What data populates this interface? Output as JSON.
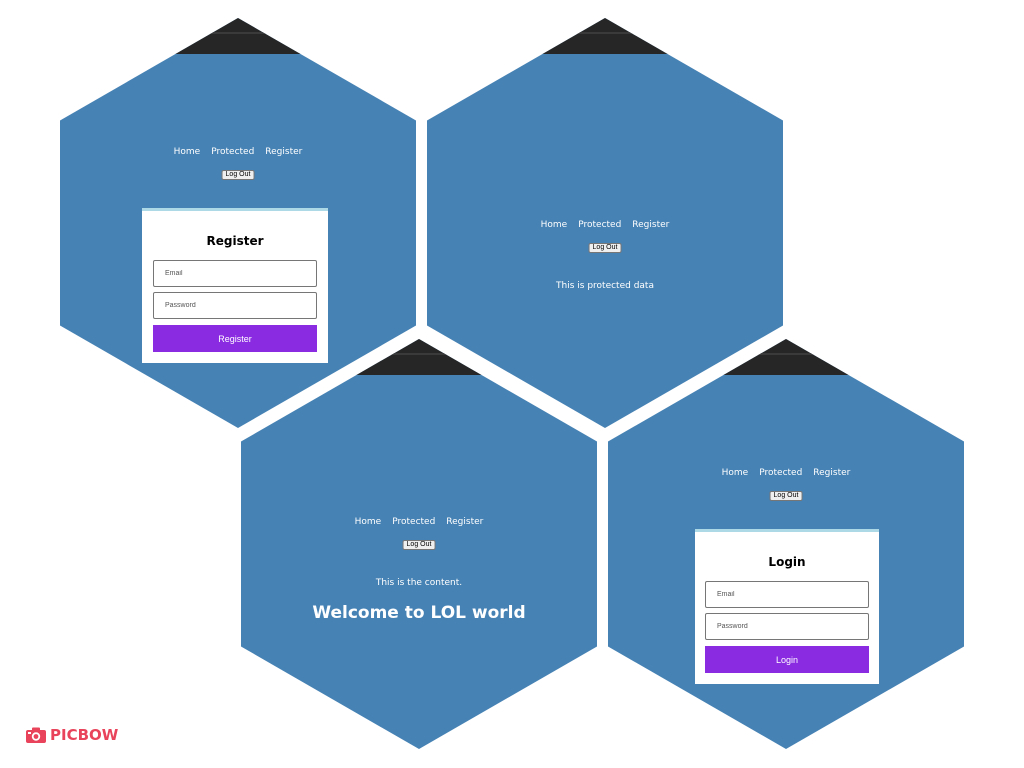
{
  "nav": {
    "home": "Home",
    "protected": "Protected",
    "register": "Register"
  },
  "logout_label": "Log Out",
  "register_panel": {
    "title": "Register",
    "email_placeholder": "Email",
    "password_placeholder": "Password",
    "submit_label": "Register"
  },
  "protected_panel": {
    "message": "This is protected data"
  },
  "home_panel": {
    "content": "This is the content.",
    "welcome": "Welcome to LOL world"
  },
  "login_panel": {
    "title": "Login",
    "email_placeholder": "Email",
    "password_placeholder": "Password",
    "submit_label": "Login"
  },
  "watermark": {
    "text": "PICBOW",
    "icon": "camera-logo-icon"
  },
  "colors": {
    "panel_bg": "#4682b4",
    "accent": "#8a2be2",
    "card_border": "#add8e6",
    "topbar": "#262626",
    "watermark": "#e8435a"
  }
}
